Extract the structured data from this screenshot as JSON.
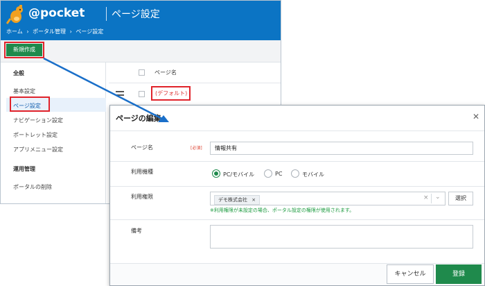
{
  "app": {
    "logo_text": "@pocket",
    "page_title": "ページ設定"
  },
  "breadcrumb": [
    "ホーム",
    "›",
    "ポータル管理",
    "›",
    "ページ設定"
  ],
  "toolbar": {
    "new_label": "新規作成"
  },
  "sidebar": {
    "section1": "全般",
    "items1": [
      "基本設定",
      "ページ設定",
      "ナビゲーション設定",
      "ポートレット設定",
      "アプリメニュー設定"
    ],
    "section2": "運用管理",
    "items2": [
      "ポータルの削除"
    ]
  },
  "list": {
    "column_header": "ページ名",
    "rows": [
      "(デフォルト)"
    ]
  },
  "dialog": {
    "title": "ページの編集",
    "close_icon": "close-icon",
    "fields": {
      "page_name_label": "ページ名",
      "required_badge": "[必須]",
      "page_name_value": "情報共有",
      "device_label": "利用機種",
      "device_options": [
        "PC/モバイル",
        "PC",
        "モバイル"
      ],
      "device_selected": "PC/モバイル",
      "permission_label": "利用権限",
      "permission_tag": "デモ株式会社",
      "select_label": "選択",
      "permission_note": "※利用権限が未設定の場合、ポータル設定の権限が使用されます。",
      "remarks_label": "備考",
      "remarks_value": ""
    },
    "cancel_label": "キャンセル",
    "save_label": "登録"
  },
  "colors": {
    "header_blue": "#0b74c4",
    "accent_green": "#1f8a4c",
    "highlight_red": "#e0222a",
    "arrow_blue": "#1a6fc9",
    "note_green": "#1a9a3e"
  }
}
